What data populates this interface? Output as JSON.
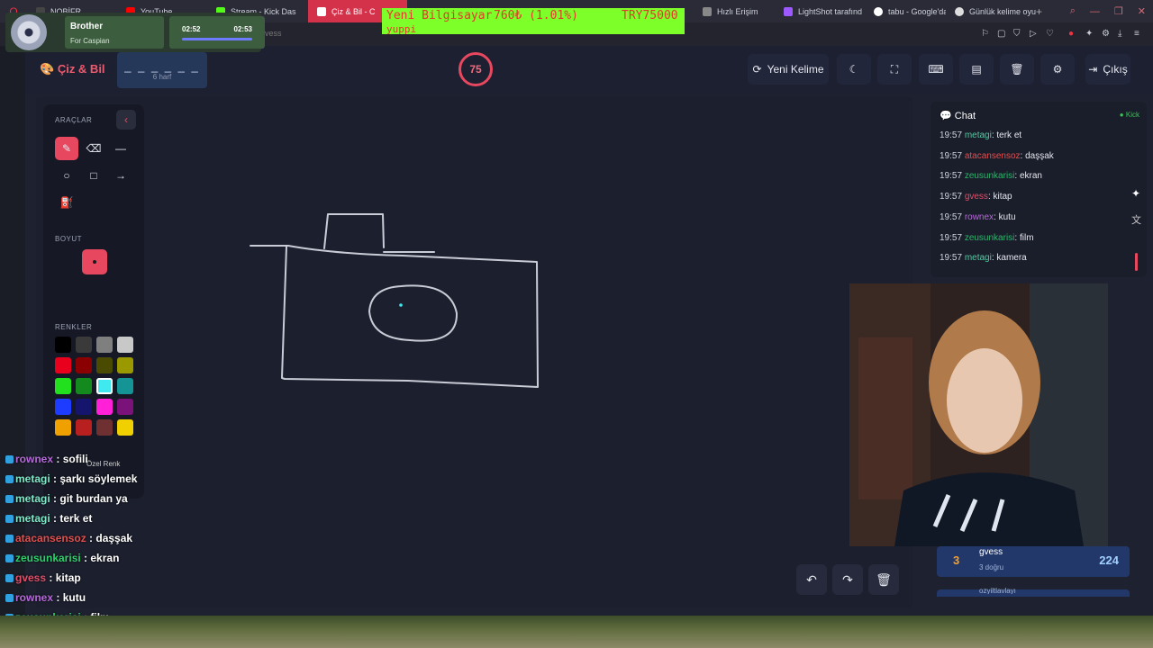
{
  "browser": {
    "tabs": [
      "NOBİFR",
      "YouTube",
      "Stream - Kick Das",
      "Çiz & Bil - C",
      "Hızlı Erişim",
      "LightShot tarafınd",
      "tabu - Google'da A",
      "Günlük kelime oyu"
    ],
    "new_tab": "+",
    "controls": [
      "—",
      "❐",
      "✕"
    ]
  },
  "music": {
    "title": "Brother",
    "artist": "For Caspian",
    "elapsed": "02:52",
    "total": "02:53"
  },
  "ticker": {
    "left": "Yeni Bilgisayar",
    "middle": "760₺ (1.01%)",
    "right": "TRY75000",
    "line2": "yuppi"
  },
  "header": {
    "logo": "Çiz & Bil",
    "word_mask": "_ _ _ _ _ _",
    "word_hint": "6 harf",
    "timer": "75",
    "new_word": "Yeni Kelime",
    "exit": "Çıkış",
    "behind_text": "gvess"
  },
  "tools": {
    "section_tools": "ARAÇLAR",
    "section_size": "BOYUT",
    "section_colors": "RENKLER",
    "custom_color": "Özel Renk",
    "colors": [
      "#000000",
      "#3a3a3a",
      "#7f7f7f",
      "#c8c8c8",
      "#e8001c",
      "#8b0000",
      "#4a4a00",
      "#9a9a00",
      "#22e01e",
      "#148a1e",
      "#40e8f0",
      "#149494",
      "#1e3cff",
      "#15156e",
      "#ff20d8",
      "#7a127a",
      "#f0a000",
      "#b82020",
      "#6e3030",
      "#f0d000"
    ],
    "selected_color": "#40e8f0"
  },
  "chat": {
    "title": "Chat",
    "status": "Kick",
    "messages": [
      {
        "time": "19:57",
        "user": "metagi",
        "color": "#55c9a0",
        "text": "terk et"
      },
      {
        "time": "19:57",
        "user": "atacansensoz",
        "color": "#e05050",
        "text": "daşşak"
      },
      {
        "time": "19:57",
        "user": "zeusunkarisi",
        "color": "#2fb56d",
        "text": "ekran"
      },
      {
        "time": "19:57",
        "user": "gvess",
        "color": "#e0506a",
        "text": "kitap"
      },
      {
        "time": "19:57",
        "user": "rownex",
        "color": "#b46ad8",
        "text": "kutu"
      },
      {
        "time": "19:57",
        "user": "zeusunkarisi",
        "color": "#2fb56d",
        "text": "film"
      },
      {
        "time": "19:57",
        "user": "metagi",
        "color": "#55c9a0",
        "text": "kamera"
      }
    ]
  },
  "leaderboard": {
    "rank": "3",
    "name": "gvess",
    "correct": "3 doğru",
    "score": "224",
    "next_name": "ozyiltlavlayı"
  },
  "stream_chat": [
    {
      "user": "rownex",
      "text": "sofili",
      "color": "#b46ad8"
    },
    {
      "user": "metagi",
      "text": "şarkı söylemek",
      "color": "#7ee8c8"
    },
    {
      "user": "metagi",
      "text": "git burdan ya",
      "color": "#7ee8c8"
    },
    {
      "user": "metagi",
      "text": "terk et",
      "color": "#7ee8c8"
    },
    {
      "user": "atacansensoz",
      "text": "daşşak",
      "color": "#e05050"
    },
    {
      "user": "zeusunkarisi",
      "text": "ekran",
      "color": "#2fd06d"
    },
    {
      "user": "gvess",
      "text": "kitap",
      "color": "#e0506a"
    },
    {
      "user": "rownex",
      "text": "kutu",
      "color": "#b46ad8"
    },
    {
      "user": "zeusunkarisi",
      "text": "film",
      "color": "#2fd06d"
    }
  ]
}
